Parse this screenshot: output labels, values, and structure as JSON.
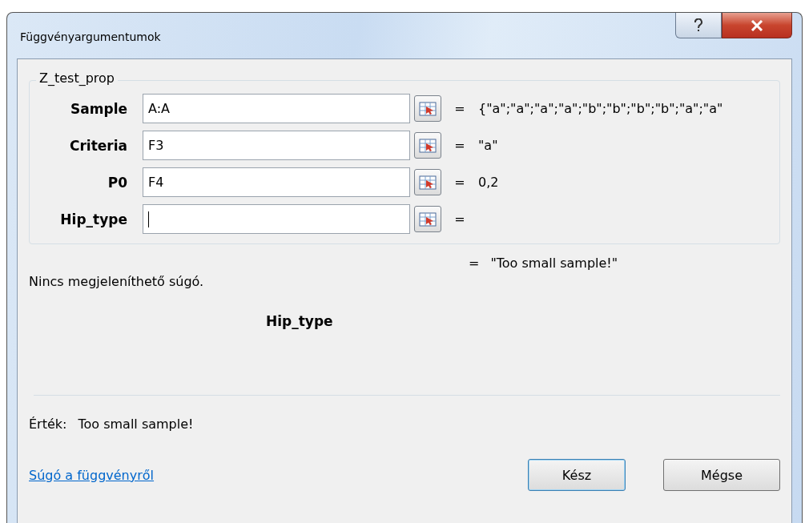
{
  "window": {
    "title": "Függvényargumentumok"
  },
  "function_group": {
    "title": "Z_test_prop",
    "arguments": [
      {
        "label": "Sample",
        "value": "A:A",
        "equals": "=",
        "result": "{\"a\";\"a\";\"a\";\"a\";\"b\";\"b\";\"b\";\"b\";\"a\";\"a\"",
        "focused": false
      },
      {
        "label": "Criteria",
        "value": "F3",
        "equals": "=",
        "result": "\"a\"",
        "focused": false
      },
      {
        "label": "P0",
        "value": "F4",
        "equals": "=",
        "result": "0,2",
        "focused": false
      },
      {
        "label": "Hip_type",
        "equals": "=",
        "focused": true
      }
    ]
  },
  "formula_result": {
    "equals": "=",
    "value": "\"Too small sample!\""
  },
  "help_text": "Nincs megjeleníthető súgó.",
  "argument_name": "Hip_type",
  "result_line": {
    "label": "Érték:",
    "value": "Too small sample!"
  },
  "help_link": "Súgó a függvényről",
  "buttons": [
    {
      "label": "Kész",
      "default": true
    },
    {
      "label": "Mégse",
      "default": false
    }
  ]
}
